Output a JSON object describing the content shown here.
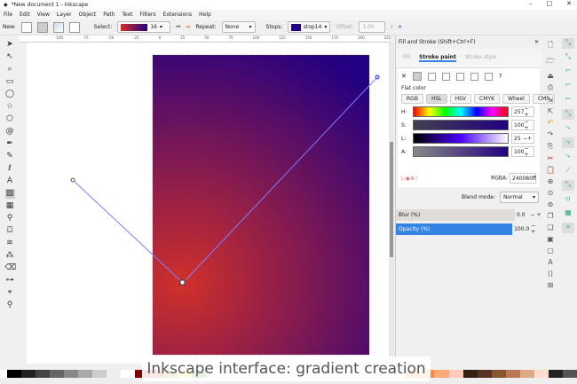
{
  "window": {
    "title": "*New document 1 - Inkscape",
    "controls": [
      "–",
      "□",
      "✕"
    ]
  },
  "menu": [
    "File",
    "Edit",
    "View",
    "Layer",
    "Object",
    "Path",
    "Text",
    "Filters",
    "Extensions",
    "Help"
  ],
  "toolbar": {
    "new_label": "New:",
    "select_label": "Select:",
    "select_value": "16",
    "repeat_label": "Repeat:",
    "repeat_value": "None",
    "stops_label": "Stops:",
    "stops_value": "stop14",
    "offset_label": "Offset:",
    "offset_value": "1.00"
  },
  "ruler": [
    "-100",
    "-75",
    "-50",
    "-25",
    "0",
    "25",
    "50",
    "75",
    "100",
    "125",
    "150",
    "175",
    "200",
    "225"
  ],
  "dock": {
    "title": "Fill and Stroke (Shift+Ctrl+F)",
    "tabs": [
      "Fill",
      "Stroke paint",
      "Stroke style"
    ],
    "paint_types": [
      "✕",
      "?"
    ],
    "flat_color": "Flat color",
    "modes": [
      "RGB",
      "HSL",
      "HSV",
      "CMYK",
      "Wheel",
      "CMS"
    ],
    "sliders": [
      {
        "label": "H:",
        "value": "257"
      },
      {
        "label": "S:",
        "value": "100"
      },
      {
        "label": "L:",
        "value": "25"
      },
      {
        "label": "A:",
        "value": "100"
      }
    ],
    "rgba_label": "RGBA:",
    "rgba_value": "240080ff",
    "blend_label": "Blend mode:",
    "blend_value": "Normal",
    "blur_label": "Blur (%)",
    "blur_value": "0.0",
    "opacity_label": "Opacity (%)",
    "opacity_value": "100.0"
  },
  "caption": "Inkscape interface: gradient creation",
  "colors": {
    "accent": "#3584e4",
    "stop_start": "#d0302a",
    "stop_end": "#240080"
  }
}
